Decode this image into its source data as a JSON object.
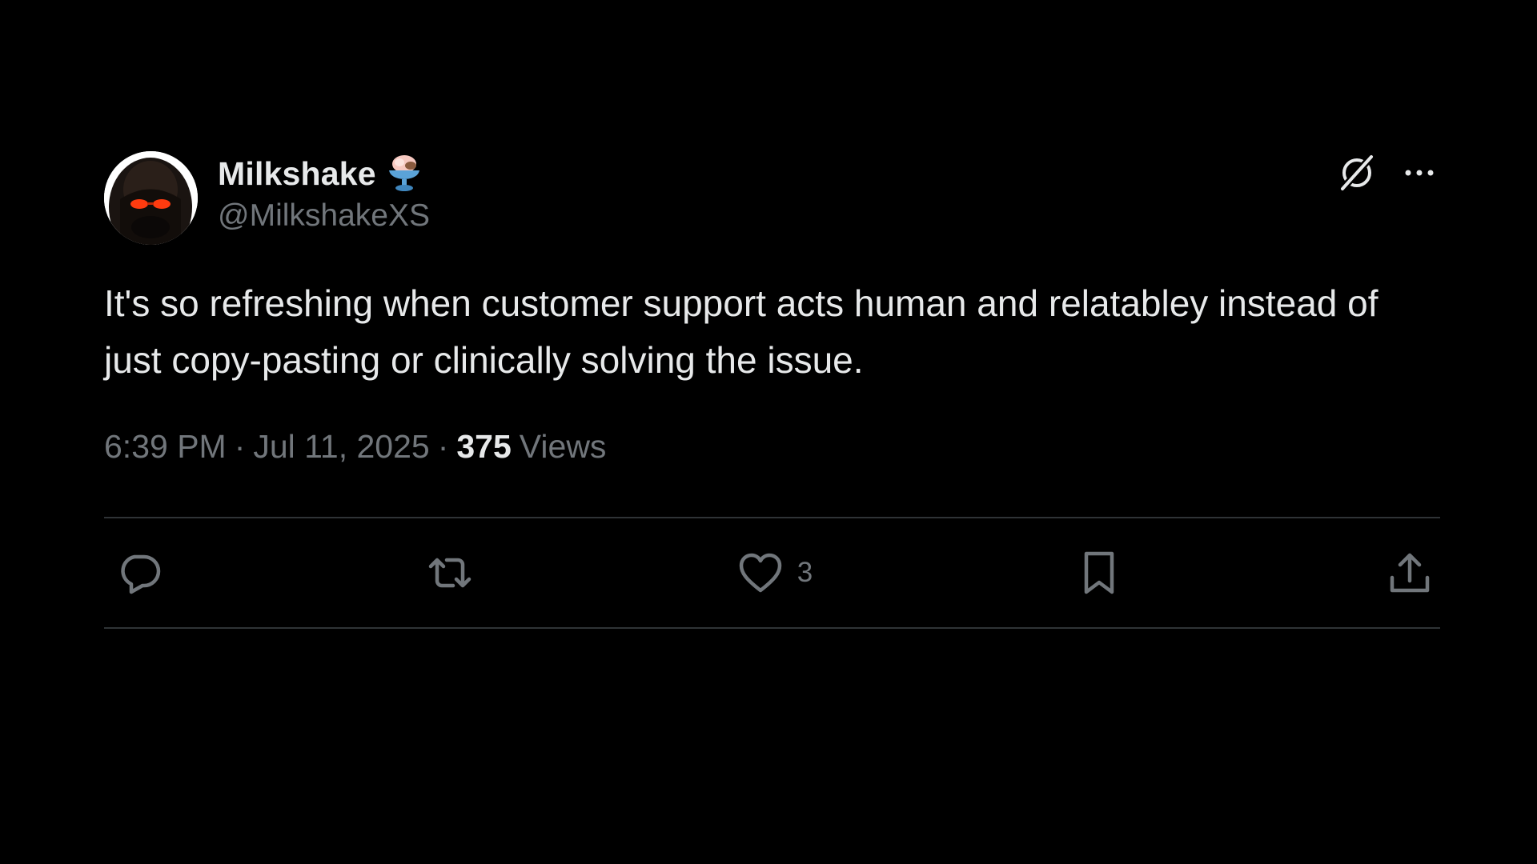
{
  "author": {
    "display_name": "Milkshake",
    "handle": "@MilkshakeXS",
    "badge_icon": "ice-cream-emoji-icon",
    "avatar_icon": "avatar-image"
  },
  "tweet": {
    "text": "It's so refreshing when customer support acts human and relatabley instead of just copy-pasting or clinically solving the issue.",
    "time": "6:39 PM",
    "date": "Jul 11, 2025",
    "separator": "·",
    "views_count": "375",
    "views_label": "Views"
  },
  "header_actions": {
    "grok_icon": "grok-icon",
    "more_icon": "more-icon"
  },
  "actions": {
    "reply_icon": "reply-icon",
    "retweet_icon": "retweet-icon",
    "like_icon": "heart-icon",
    "like_count": "3",
    "bookmark_icon": "bookmark-icon",
    "share_icon": "share-icon"
  },
  "colors": {
    "background": "#000000",
    "text_primary": "#e7e9ea",
    "text_secondary": "#71767b",
    "divider": "#2f3336"
  }
}
